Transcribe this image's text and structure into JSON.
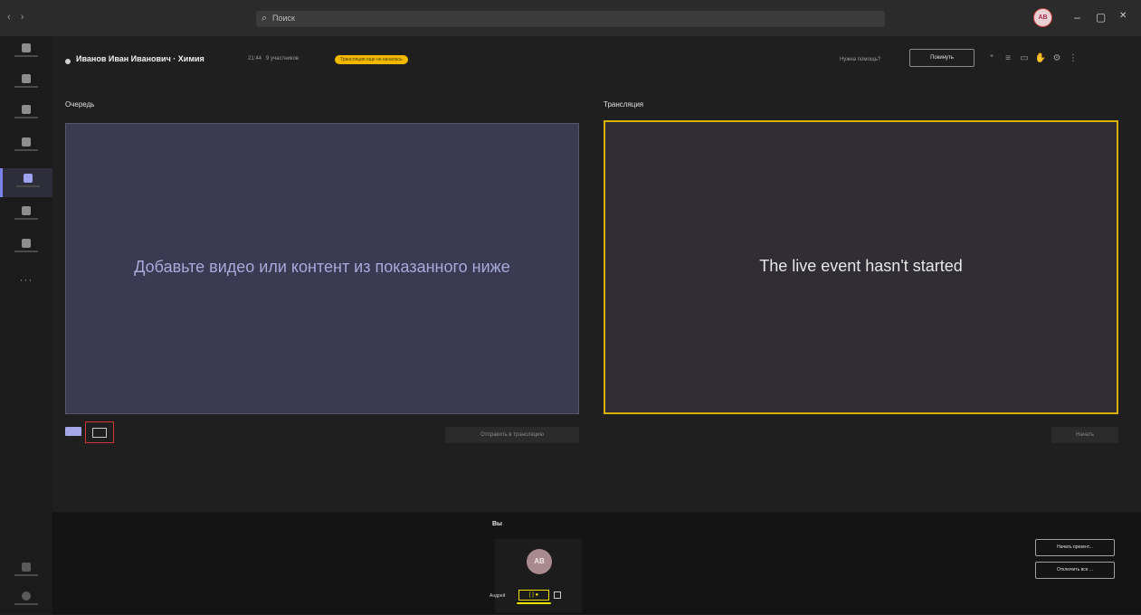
{
  "titlebar": {
    "nav": "‹ ›",
    "search_placeholder": "Поиск",
    "avatar_initials": "АВ",
    "minimize": "–",
    "maximize": "▢",
    "close": "✕"
  },
  "rail": {
    "items": [
      "activity",
      "chat",
      "teams",
      "calendar",
      "calls-active",
      "calls",
      "files"
    ],
    "more": "···"
  },
  "header": {
    "title": "Иванов Иван Иванович · Химия",
    "time": "21:44",
    "participants": "9 участников",
    "badge": "Трансляция еще не началась",
    "help": "Нужна помощь?",
    "leave": "Покинуть"
  },
  "queue": {
    "label": "Очередь",
    "placeholder_text": "Добавьте видео или контент из показанного ниже",
    "send_button": "Отправить в трансляцию"
  },
  "broadcast": {
    "label": "Трансляция",
    "status_text": "The live event hasn't started",
    "start_button": "Начать"
  },
  "bottom": {
    "you_label": "Вы",
    "avatar_initials": "АВ",
    "name": "Андрей",
    "controls": "[ ]  ●",
    "start_presenting": "Начать презент...",
    "mute_all": "Отключить все ..."
  },
  "colors": {
    "accent": "#7b83eb",
    "badge": "#f2b800",
    "highlight": "#d9b000"
  }
}
